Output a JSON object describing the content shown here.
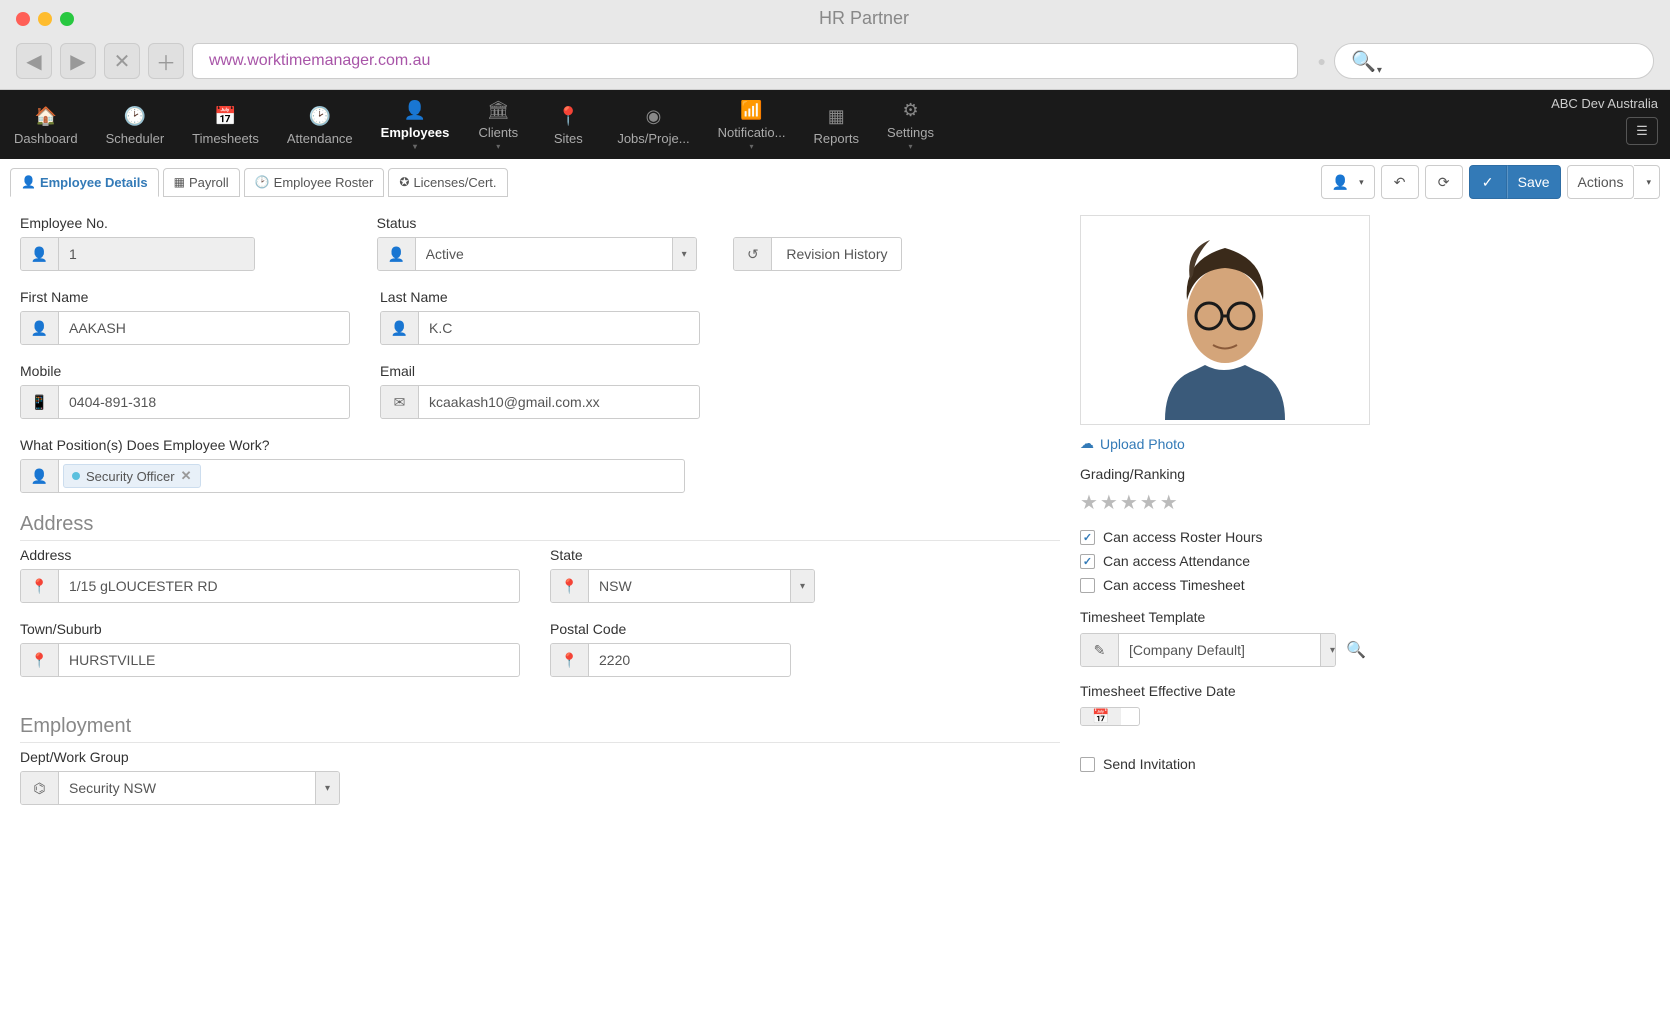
{
  "window": {
    "title": "HR Partner",
    "url": "www.worktimemanager.com.au"
  },
  "nav": {
    "items": [
      {
        "label": "Dashboard",
        "icon": "home"
      },
      {
        "label": "Scheduler",
        "icon": "clock"
      },
      {
        "label": "Timesheets",
        "icon": "calendar"
      },
      {
        "label": "Attendance",
        "icon": "clock"
      },
      {
        "label": "Employees",
        "icon": "person",
        "active": true,
        "caret": true
      },
      {
        "label": "Clients",
        "icon": "building",
        "caret": true
      },
      {
        "label": "Sites",
        "icon": "pin"
      },
      {
        "label": "Jobs/Proje...",
        "icon": "dash"
      },
      {
        "label": "Notificatio...",
        "icon": "feed",
        "caret": true
      },
      {
        "label": "Reports",
        "icon": "grid"
      },
      {
        "label": "Settings",
        "icon": "gear",
        "caret": true
      }
    ],
    "company": "ABC Dev Australia"
  },
  "tabs": [
    {
      "label": "Employee Details",
      "active": true
    },
    {
      "label": "Payroll"
    },
    {
      "label": "Employee Roster"
    },
    {
      "label": "Licenses/Cert."
    }
  ],
  "actions": {
    "save": "Save",
    "actions": "Actions"
  },
  "form": {
    "employee_no": {
      "label": "Employee No.",
      "value": "1"
    },
    "status": {
      "label": "Status",
      "value": "Active"
    },
    "revision": "Revision History",
    "first_name": {
      "label": "First Name",
      "value": "AAKASH"
    },
    "last_name": {
      "label": "Last Name",
      "value": "K.C"
    },
    "mobile": {
      "label": "Mobile",
      "value": "0404-891-318"
    },
    "email": {
      "label": "Email",
      "value": "kcaakash10@gmail.com.xx"
    },
    "positions": {
      "label": "What Position(s) Does Employee Work?",
      "tag": "Security Officer"
    },
    "address_section": "Address",
    "address": {
      "label": "Address",
      "value": "1/15 gLOUCESTER RD"
    },
    "state": {
      "label": "State",
      "value": "NSW"
    },
    "town": {
      "label": "Town/Suburb",
      "value": "HURSTVILLE"
    },
    "postal": {
      "label": "Postal Code",
      "value": "2220"
    },
    "employment_section": "Employment",
    "dept": {
      "label": "Dept/Work Group",
      "value": "Security NSW"
    }
  },
  "sidebar": {
    "upload": "Upload Photo",
    "grading_label": "Grading/Ranking",
    "checks": [
      {
        "label": "Can access Roster Hours",
        "checked": true
      },
      {
        "label": "Can access Attendance",
        "checked": true
      },
      {
        "label": "Can access Timesheet",
        "checked": false
      }
    ],
    "template": {
      "label": "Timesheet Template",
      "value": "[Company Default]"
    },
    "effective": {
      "label": "Timesheet Effective Date",
      "value": ""
    },
    "send_invitation": {
      "label": "Send Invitation",
      "checked": false
    }
  }
}
